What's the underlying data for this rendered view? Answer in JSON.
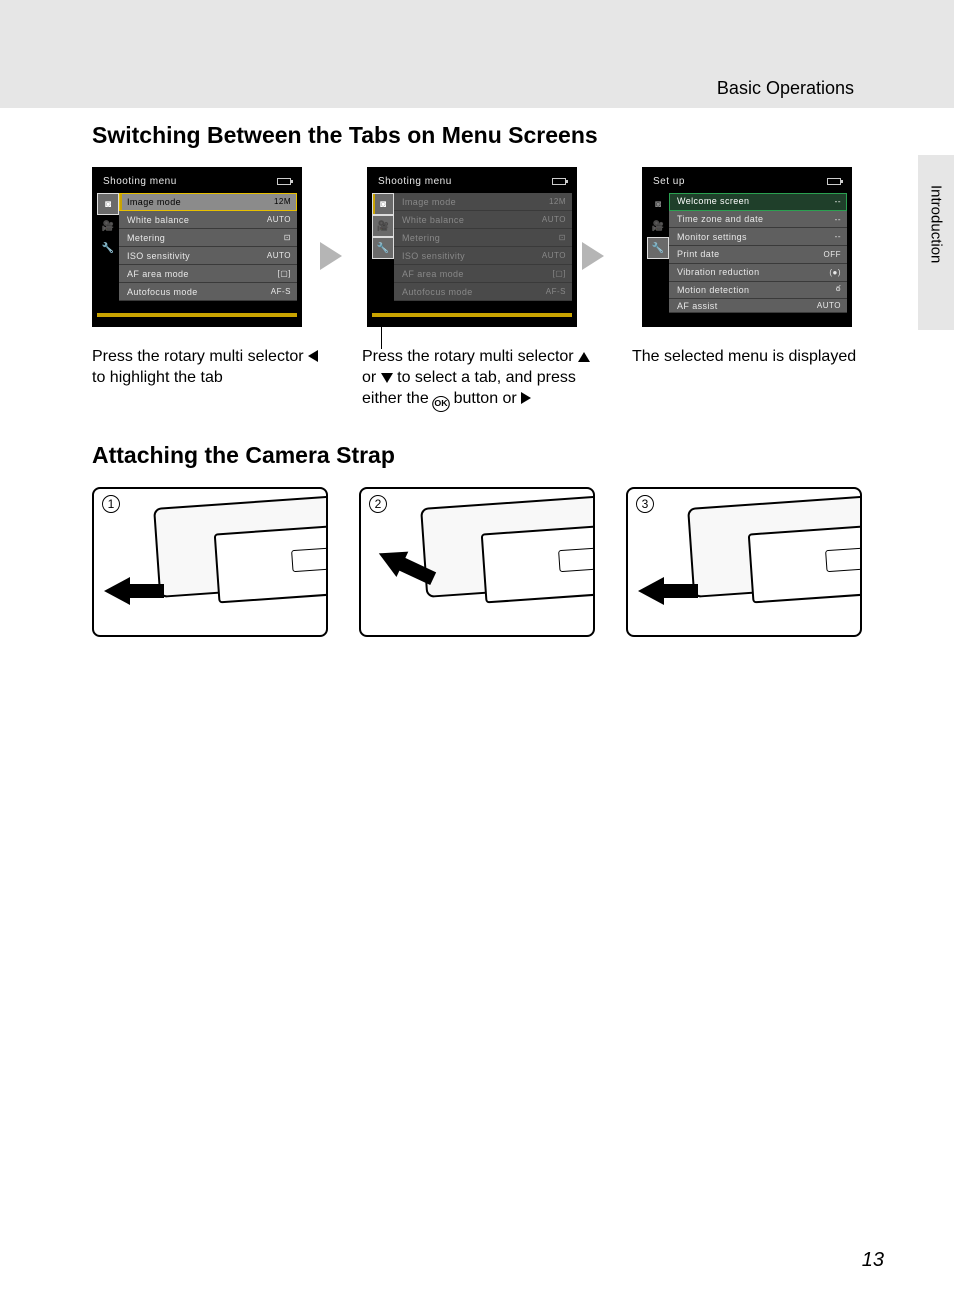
{
  "header": {
    "section": "Basic Operations"
  },
  "side_tab": "Introduction",
  "page_number": "13",
  "h1": "Switching Between the Tabs on Menu Screens",
  "h2": "Attaching the Camera Strap",
  "screens": [
    {
      "title": "Shooting menu",
      "active_tab": 0,
      "rows": [
        {
          "label": "Image mode",
          "val": "12M",
          "cls": "highlight"
        },
        {
          "label": "White balance",
          "val": "AUTO",
          "cls": ""
        },
        {
          "label": "Metering",
          "val": "⊡",
          "cls": ""
        },
        {
          "label": "ISO sensitivity",
          "val": "AUTO",
          "cls": ""
        },
        {
          "label": "AF area mode",
          "val": "[▢]",
          "cls": ""
        },
        {
          "label": "Autofocus mode",
          "val": "AF-S",
          "cls": ""
        }
      ]
    },
    {
      "title": "Shooting menu",
      "active_tab": 0,
      "rows": [
        {
          "label": "Image mode",
          "val": "12M",
          "cls": "dim"
        },
        {
          "label": "White balance",
          "val": "AUTO",
          "cls": "dim"
        },
        {
          "label": "Metering",
          "val": "⊡",
          "cls": "dim"
        },
        {
          "label": "ISO sensitivity",
          "val": "AUTO",
          "cls": "dim"
        },
        {
          "label": "AF area mode",
          "val": "[▢]",
          "cls": "dim"
        },
        {
          "label": "Autofocus mode",
          "val": "AF-S",
          "cls": "dim"
        }
      ]
    },
    {
      "title": "Set up",
      "active_tab": 2,
      "rows": [
        {
          "label": "Welcome screen",
          "val": "--",
          "cls": "green-highlight"
        },
        {
          "label": "Time zone and date",
          "val": "--",
          "cls": ""
        },
        {
          "label": "Monitor settings",
          "val": "--",
          "cls": ""
        },
        {
          "label": "Print date",
          "val": "OFF",
          "cls": ""
        },
        {
          "label": "Vibration reduction",
          "val": "(●)",
          "cls": ""
        },
        {
          "label": "Motion detection",
          "val": "ఠ",
          "cls": ""
        },
        {
          "label": "AF assist",
          "val": "AUTO",
          "cls": ""
        }
      ]
    }
  ],
  "captions": {
    "c1a": "Press the rotary multi selector ",
    "c1b": " to highlight the tab",
    "c2a": "Press the rotary multi selector ",
    "c2b": " or ",
    "c2c": " to select a tab, and press either the ",
    "c2d": " button or ",
    "c3": "The selected menu is displayed"
  },
  "ok_label": "OK",
  "strap_steps": [
    "1",
    "2",
    "3"
  ]
}
